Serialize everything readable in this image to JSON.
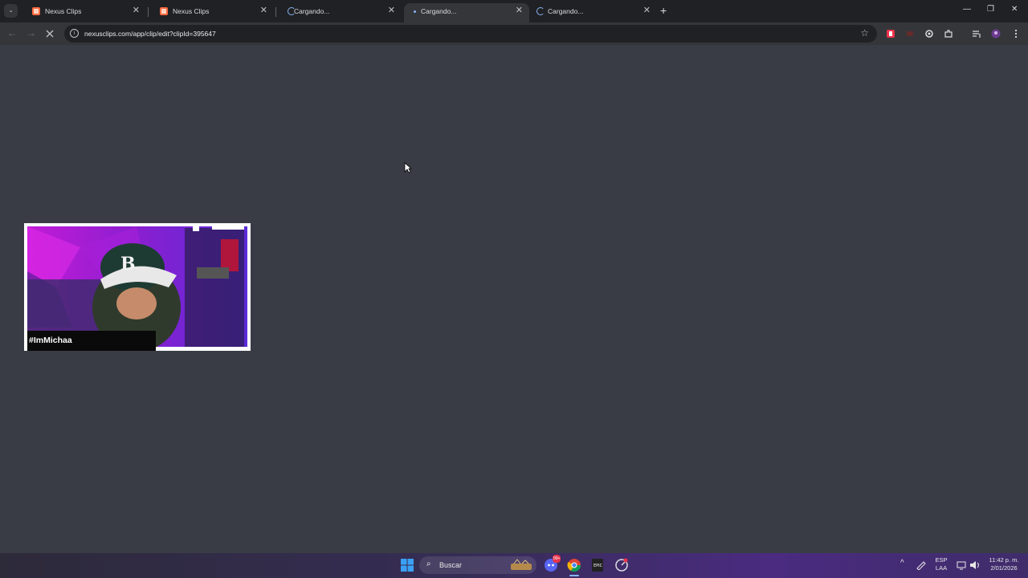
{
  "browser": {
    "tabs": [
      {
        "title": "Nexus Clips",
        "close": "✕"
      },
      {
        "title": "Nexus Clips",
        "close": "✕"
      },
      {
        "title": "Cargando...",
        "close": "✕"
      },
      {
        "title": "Cargando...",
        "close": "✕"
      },
      {
        "title": "Cargando...",
        "close": "✕"
      }
    ],
    "new_tab": "+",
    "tab_menu": "⌄",
    "window_controls": {
      "minimize": "—",
      "restore": "❐",
      "close": "✕"
    },
    "url": "nexusclips.com/app/clip/edit?clipId=395647",
    "nav": {
      "back": "←",
      "forward": "→"
    },
    "star": "☆",
    "extensions": [
      "bookmark-ext-icon",
      "spider-ext-icon",
      "sync-ext-icon",
      "puzzle-extensions-icon",
      "reading-list-icon",
      "profile-avatar-icon",
      "menu-kebab-icon"
    ]
  },
  "clip": {
    "caption": "#ImMichaa"
  },
  "taskbar": {
    "search_label": "Buscar",
    "language": "ESP",
    "layout": "LAA",
    "time": "11:42 p. m.",
    "date": "2/01/2026",
    "tray_chevron": "^",
    "discord_badge": "99+"
  },
  "colors": {
    "content_bg": "#393c45",
    "tabbar_bg": "#202124",
    "toolbar_bg": "#35363a",
    "accent": "#8ab4f8"
  }
}
